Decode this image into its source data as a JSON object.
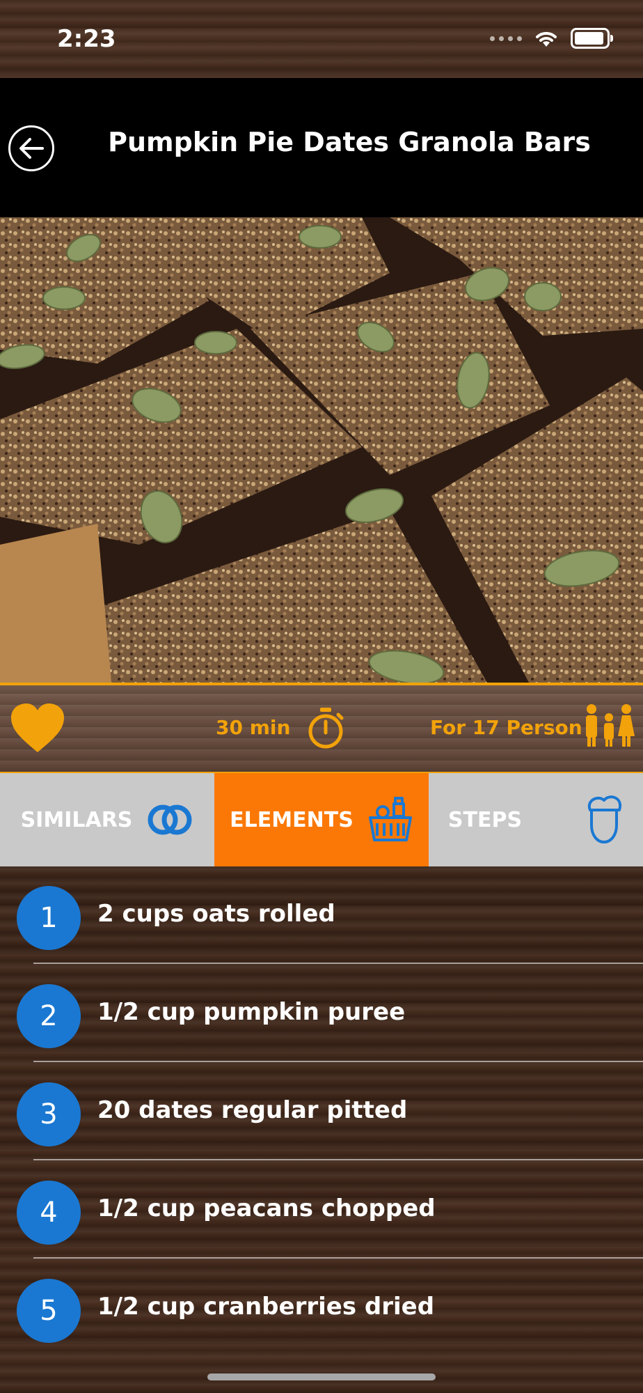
{
  "status_bar": {
    "time": "2:23"
  },
  "header": {
    "title": "Pumpkin Pie Dates Granola Bars",
    "back_icon": "arrow-left-circle-icon"
  },
  "hero_image": {
    "alt": "Granola bars photo"
  },
  "meta": {
    "favorite_icon": "heart-icon",
    "duration": "30 min",
    "timer_icon": "stopwatch-icon",
    "servings": "For 17 Person",
    "people_icon": "family-icon",
    "accent_color": "#f2a20a"
  },
  "tabs": [
    {
      "label": "SIMILARS",
      "icon": "rings-icon"
    },
    {
      "label": "ELEMENTS",
      "icon": "basket-icon",
      "active": true
    },
    {
      "label": "STEPS",
      "icon": "chef-icon"
    }
  ],
  "ingredients": [
    {
      "number": "1",
      "text": "2 cups oats rolled"
    },
    {
      "number": "2",
      "text": "1/2 cup pumpkin puree"
    },
    {
      "number": "3",
      "text": "20 dates regular pitted"
    },
    {
      "number": "4",
      "text": "1/2 cup peacans chopped"
    },
    {
      "number": "5",
      "text": "1/2 cup cranberries dried"
    }
  ],
  "colors": {
    "tab_active": "#fb7806",
    "tab_inactive": "#c9c9c9",
    "number_badge": "#1a78d2"
  }
}
